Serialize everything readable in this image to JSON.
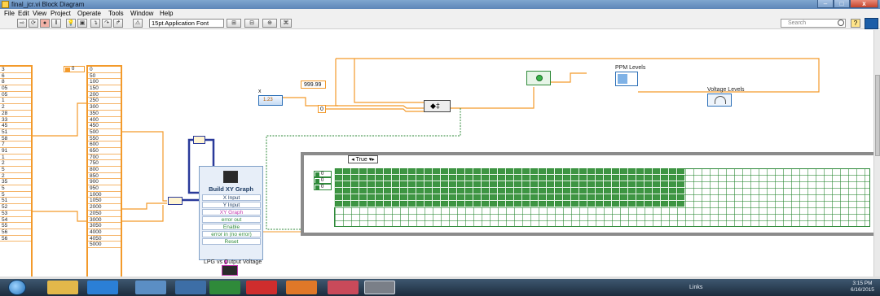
{
  "window": {
    "title": "final_jcr.vi Block Diagram"
  },
  "menu": [
    "File",
    "Edit",
    "View",
    "Project",
    "Operate",
    "Tools",
    "Window",
    "Help"
  ],
  "toolbar": {
    "font": "15pt Application Font",
    "search_placeholder": "Search"
  },
  "left_array": [
    "3",
    "6",
    "8",
    "05",
    "05",
    "1",
    "2",
    "28",
    "33",
    "45",
    "51",
    "58",
    "7",
    "91",
    "1",
    "2",
    "5",
    "2",
    "35",
    "5",
    "5",
    "51",
    "52",
    "53",
    "54",
    "55",
    "56",
    "56"
  ],
  "left_index": "0",
  "right_array": [
    "0",
    "50",
    "100",
    "150",
    "200",
    "250",
    "300",
    "350",
    "400",
    "450",
    "500",
    "550",
    "600",
    "650",
    "700",
    "750",
    "800",
    "850",
    "900",
    "950",
    "1000",
    "1050",
    "2000",
    "2050",
    "3000",
    "3050",
    "4000",
    "4050",
    "5000"
  ],
  "nodes": {
    "x_label": "x",
    "const_999": "999.99",
    "const_0": "0",
    "ppm_label": "PPM Levels",
    "voltage_label": "Voltage Levels",
    "lpg_label": "LPG vs Output Voltage"
  },
  "build_xy": {
    "title": "Build XY Graph",
    "terminals": [
      "X Input",
      "Y Input",
      "XY Graph",
      "error out",
      "Enable",
      "error in (no error)",
      "Reset"
    ]
  },
  "case_structure": {
    "selector": "True",
    "consts": [
      "0",
      "0",
      "0"
    ]
  },
  "taskbar": {
    "links": "Links",
    "time": "3:15 PM",
    "date": "6/16/2015"
  }
}
